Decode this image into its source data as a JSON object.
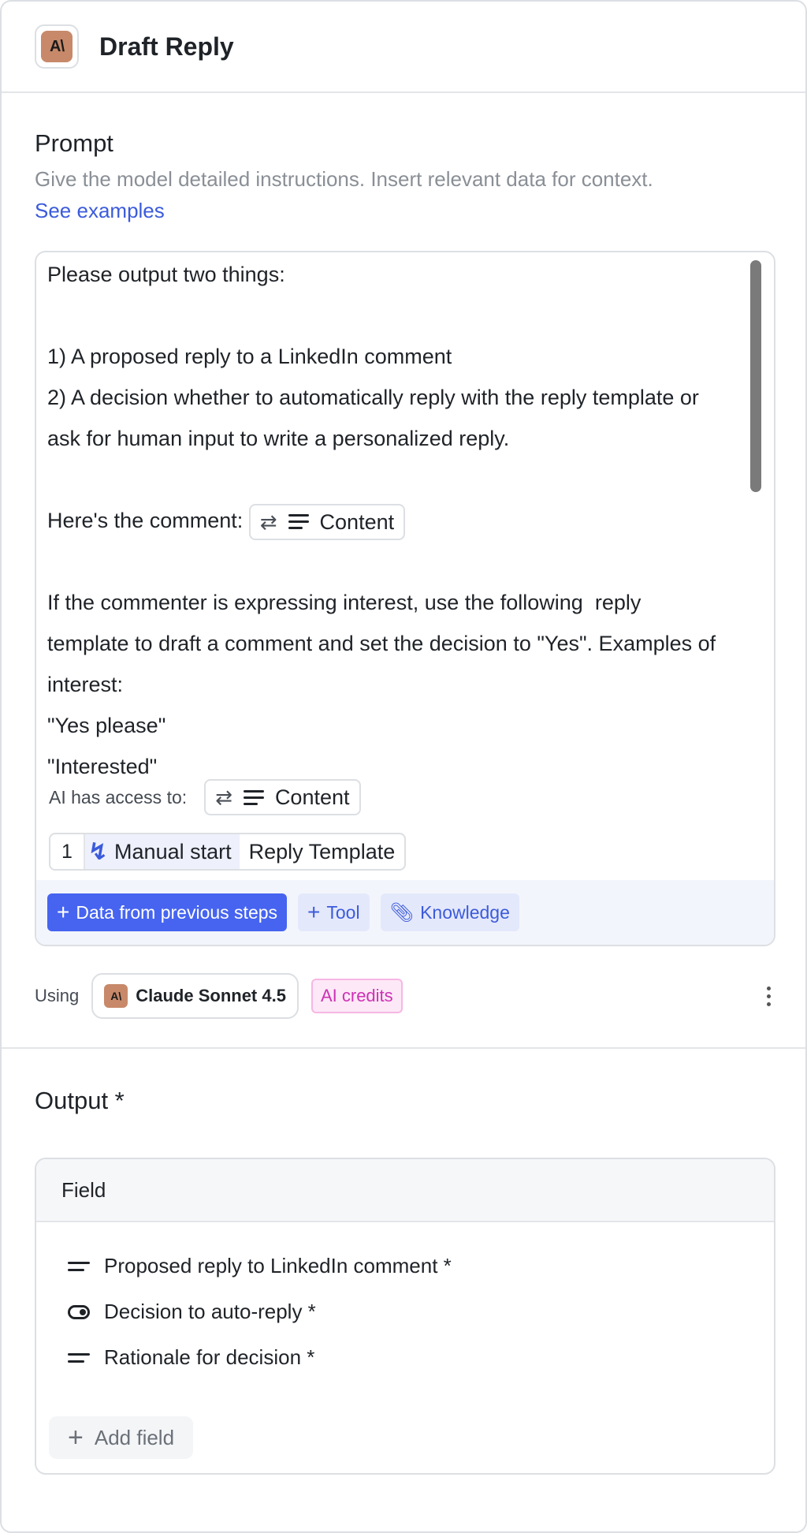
{
  "header": {
    "title": "Draft Reply",
    "icon_label": "A\\"
  },
  "prompt": {
    "title": "Prompt",
    "description": "Give the model detailed instructions. Insert relevant data for context.",
    "examples_link": "See examples",
    "lines": [
      "Please output two things:",
      "",
      "1) A proposed reply to a LinkedIn comment",
      "2) A decision whether to automatically reply with the reply template or",
      "ask for human input to write a personalized reply.",
      "",
      "Here's the comment: ",
      "",
      "If the commenter is expressing interest, use the following  reply",
      "template to draft a comment and set the decision to \"Yes\". Examples of",
      "interest:",
      "\"Yes please\"",
      "\"Interested\""
    ],
    "comment_chip": "Content",
    "access_label": "AI has access to:",
    "access_chip": "Content",
    "manual_step": {
      "number": "1",
      "name": "Manual start",
      "field": "Reply Template"
    },
    "buttons": {
      "data_label": "Data from previous steps",
      "tool_label": "Tool",
      "knowledge_label": "Knowledge"
    }
  },
  "model": {
    "using_label": "Using",
    "name": "Claude Sonnet 4.5",
    "icon_label": "A\\",
    "credits_label": "AI credits"
  },
  "output": {
    "title": "Output *",
    "table_header": "Field",
    "fields": [
      {
        "label": "Proposed reply to LinkedIn comment *",
        "type": "text"
      },
      {
        "label": "Decision to auto-reply *",
        "type": "boolean"
      },
      {
        "label": "Rationale for decision *",
        "type": "text"
      }
    ],
    "add_field_label": "Add field"
  },
  "colors": {
    "accent": "#4664f0",
    "link": "#3b5bdb",
    "brand_icon": "#c7896a",
    "credits_text": "#cc32b4",
    "credits_bg": "#fde8f7"
  }
}
